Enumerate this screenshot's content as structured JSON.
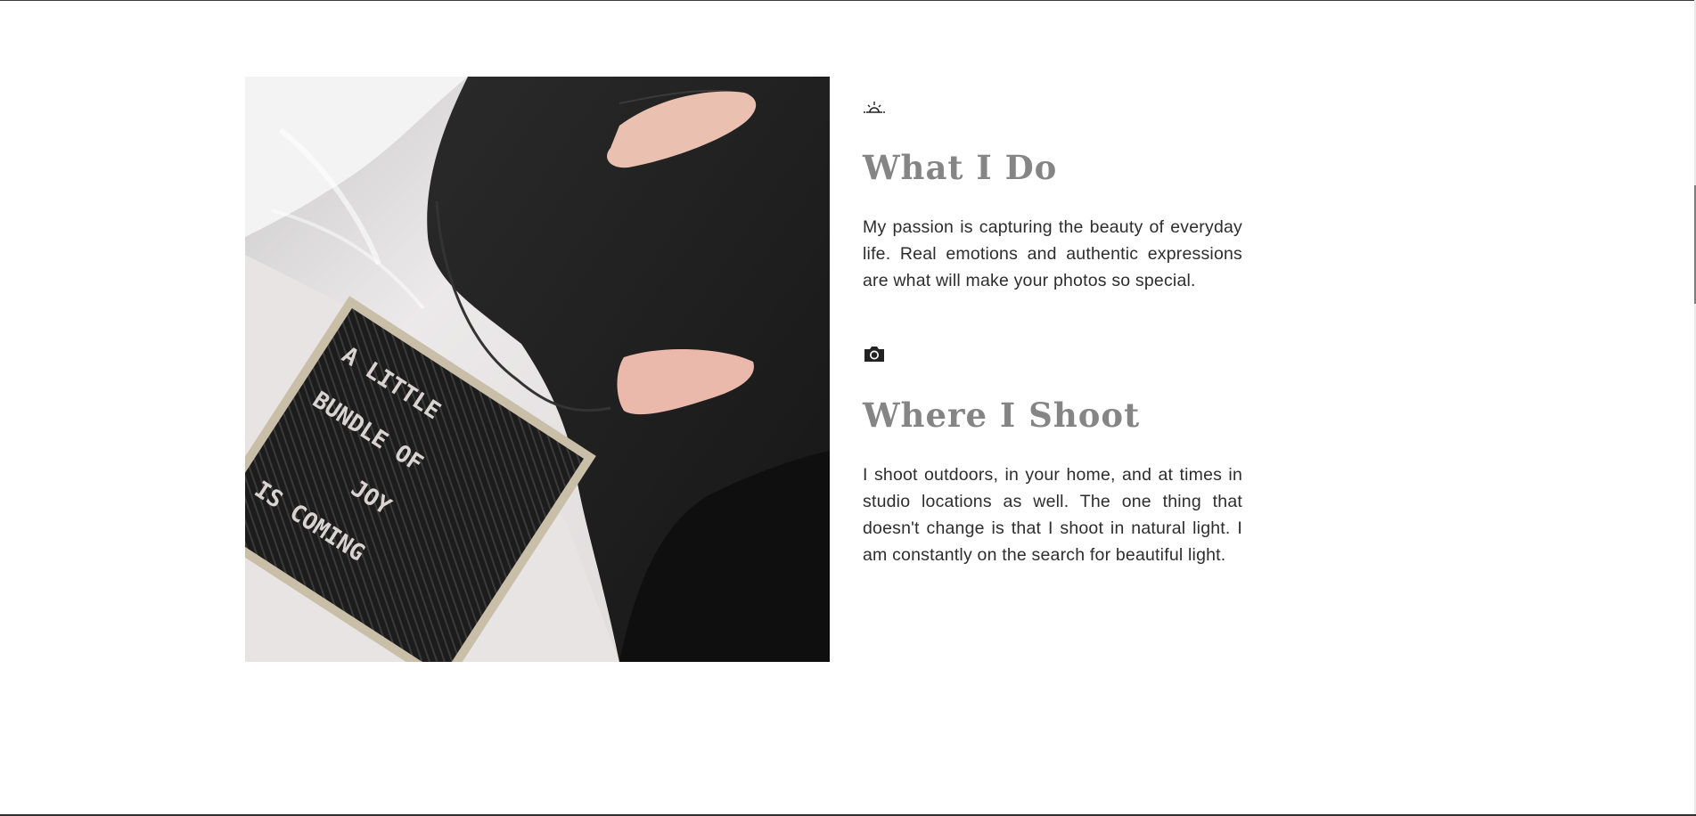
{
  "colors": {
    "heading": "#858585",
    "body_text": "#2d2d2d",
    "background": "#ffffff"
  },
  "photo": {
    "letter_board_lines": [
      "A LITTLE",
      "BUNDLE OF",
      "JOY",
      "IS COMING"
    ]
  },
  "sections": [
    {
      "icon": "sunrise-icon",
      "title": "What I Do",
      "body": "My passion is capturing the beauty of everyday life. Real emotions and authentic expressions are what will make your photos so special."
    },
    {
      "icon": "camera-icon",
      "title": "Where I Shoot",
      "body": "I shoot outdoors, in your home, and at times in studio locations as well. The one thing that doesn't change is that I shoot in natural light. I am constantly on the search for beautiful light."
    }
  ]
}
